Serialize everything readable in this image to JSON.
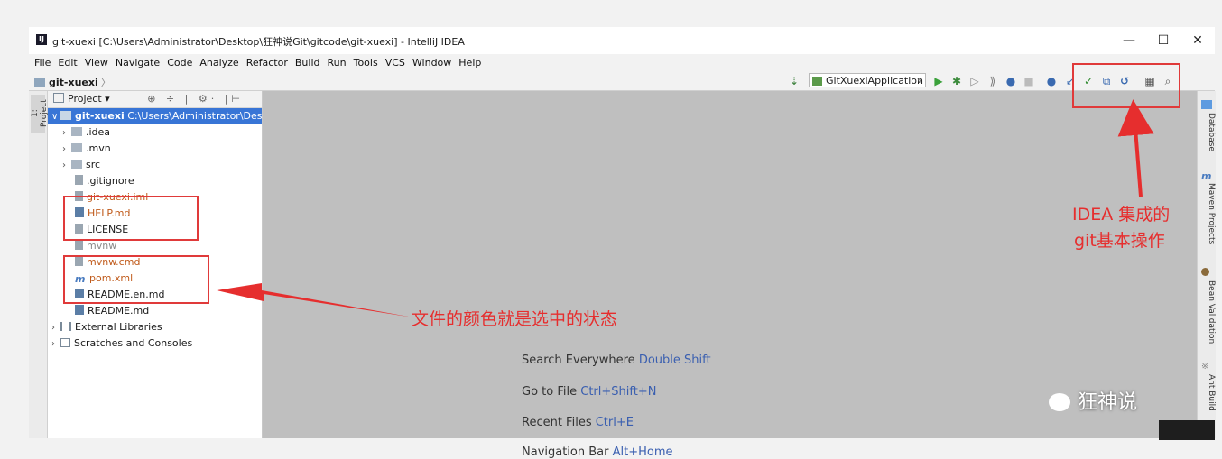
{
  "window": {
    "title": "git-xuexi [C:\\Users\\Administrator\\Desktop\\狂神说Git\\gitcode\\git-xuexi] - IntelliJ IDEA",
    "controls": [
      "—",
      "☐",
      "✕"
    ]
  },
  "menu": [
    "File",
    "Edit",
    "View",
    "Navigate",
    "Code",
    "Analyze",
    "Refactor",
    "Build",
    "Run",
    "Tools",
    "VCS",
    "Window",
    "Help"
  ],
  "navbar": {
    "breadcrumb": "git-xuexi",
    "breadcrumb_sep": "〉",
    "run_config": "GitXuexiApplication",
    "toolbar_icons": [
      "build-icon",
      "run-icon",
      "debug-icon",
      "run-coverage-icon",
      "profile-icon",
      "stop-icon",
      "update-project-icon",
      "vcs-update-icon",
      "vcs-commit-icon",
      "vcs-compare-icon",
      "vcs-history-icon",
      "vcs-revert-icon",
      "project-structure-icon",
      "search-everywhere-icon"
    ]
  },
  "left_strip": {
    "tab": "1: Project"
  },
  "project_panel": {
    "header": "Project",
    "tools": "⊕ ÷ | ⚙· |⊢",
    "tree": [
      {
        "label": "git-xuexi",
        "path": "C:\\Users\\Administrator\\Deskto",
        "selected": true
      },
      {
        "label": ".idea"
      },
      {
        "label": ".mvn"
      },
      {
        "label": "src"
      },
      {
        "label": ".gitignore"
      },
      {
        "label": "git-xuexi.iml"
      },
      {
        "label": "HELP.md"
      },
      {
        "label": "LICENSE"
      },
      {
        "label": "mvnw"
      },
      {
        "label": "mvnw.cmd"
      },
      {
        "label": "pom.xml"
      },
      {
        "label": "README.en.md"
      },
      {
        "label": "README.md"
      },
      {
        "label": "External Libraries"
      },
      {
        "label": "Scratches and Consoles"
      }
    ]
  },
  "editor_hints": [
    {
      "text": "Search Everywhere",
      "key": "Double Shift"
    },
    {
      "text": "Go to File",
      "key": "Ctrl+Shift+N"
    },
    {
      "text": "Recent Files",
      "key": "Ctrl+E"
    },
    {
      "text": "Navigation Bar",
      "key": "Alt+Home"
    }
  ],
  "right_strip": [
    "Database",
    "Maven Projects",
    "Bean Validation",
    "Ant Build"
  ],
  "annotations": {
    "git_ops_line1": "IDEA 集成的",
    "git_ops_line2": "git基本操作",
    "file_color": "文件的颜色就是选中的状态"
  },
  "watermark": "狂神说",
  "colors": {
    "selection": "#3875d6",
    "annotation_red": "#e62e2e",
    "modified_file": "#c05a1a",
    "editor_bg": "#bfbfbf",
    "hint_key": "#3a5fb0"
  }
}
